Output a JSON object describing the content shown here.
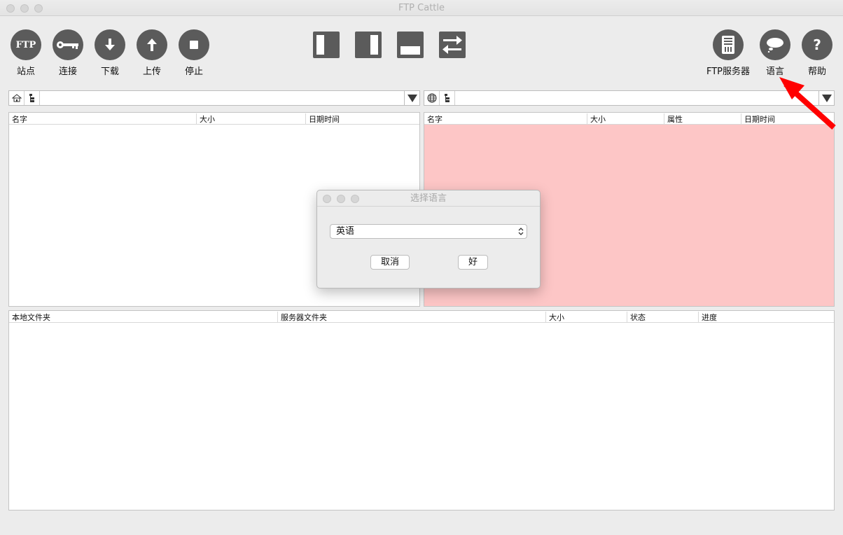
{
  "window": {
    "title": "FTP Cattle"
  },
  "toolbar": {
    "site": {
      "label": "站点",
      "icon_text": "FTP"
    },
    "connect": {
      "label": "连接"
    },
    "download": {
      "label": "下载"
    },
    "upload": {
      "label": "上传"
    },
    "stop": {
      "label": "停止"
    },
    "ftp_server": {
      "label": "FTP服务器"
    },
    "language": {
      "label": "语言"
    },
    "help": {
      "label": "帮助"
    }
  },
  "local_panel": {
    "columns": [
      "名字",
      "大小",
      "日期时间"
    ]
  },
  "remote_panel": {
    "columns": [
      "名字",
      "大小",
      "属性",
      "日期时间"
    ],
    "background": "#fdc6c6"
  },
  "queue_panel": {
    "columns": [
      "本地文件夹",
      "服务器文件夹",
      "大小",
      "状态",
      "进度"
    ]
  },
  "dialog": {
    "title": "选择语言",
    "selected_language": "英语",
    "cancel_label": "取消",
    "ok_label": "好"
  },
  "annotation": {
    "arrow_color": "#ff0000"
  }
}
